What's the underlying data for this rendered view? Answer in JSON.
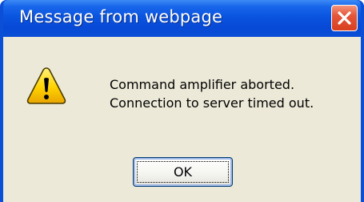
{
  "dialog": {
    "title": "Message from webpage",
    "message_lines": [
      "Command amplifier aborted.",
      "Connection to server timed out."
    ],
    "ok_label": "OK",
    "icon": "warning-icon",
    "close_icon": "close-icon"
  },
  "colors": {
    "titlebar": "#0a4fd6",
    "client_background": "#ece9d8",
    "close_button": "#d8401f",
    "warning_yellow": "#ffd200"
  }
}
